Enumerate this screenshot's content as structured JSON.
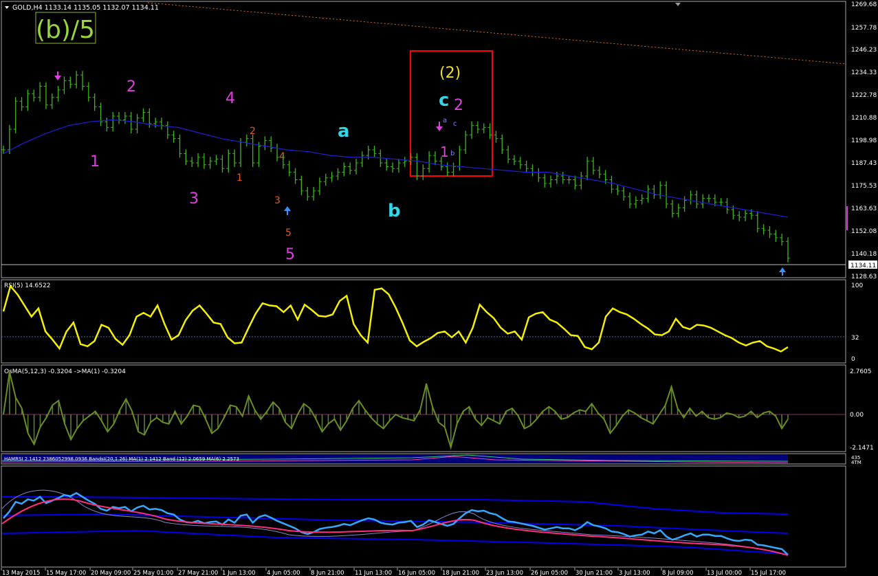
{
  "window": {
    "symbol_header": "GOLD,H4  1133.14 1135.05 1132.07 1134.11",
    "wave_title": "(b)/5"
  },
  "price_panel": {
    "y_labels": [
      "1269.68",
      "1257.78",
      "1246.23",
      "1234.33",
      "1222.78",
      "1210.88",
      "1198.98",
      "1187.43",
      "1175.53",
      "1163.63",
      "1152.08",
      "1140.18",
      "1128.63"
    ],
    "current_price": "1134.11",
    "wave_labels": [
      {
        "text": "2",
        "color": "#e040e0",
        "size": "big"
      },
      {
        "text": "4",
        "color": "#e040e0",
        "size": "big"
      },
      {
        "text": "1",
        "color": "#e040e0",
        "size": "big"
      },
      {
        "text": "3",
        "color": "#e040e0",
        "size": "big"
      },
      {
        "text": "5",
        "color": "#e040e0",
        "size": "big"
      },
      {
        "text": "2",
        "color": "#e05a20",
        "size": "small"
      },
      {
        "text": "4",
        "color": "#e05a20",
        "size": "small"
      },
      {
        "text": "1",
        "color": "#e05a20",
        "size": "small"
      },
      {
        "text": "3",
        "color": "#e05a20",
        "size": "small"
      },
      {
        "text": "5",
        "color": "#e05a20",
        "size": "small"
      },
      {
        "text": "a",
        "color": "#33d6e8",
        "size": "big"
      },
      {
        "text": "b",
        "color": "#33d6e8",
        "size": "big"
      },
      {
        "text": "c",
        "color": "#33d6e8",
        "size": "big"
      },
      {
        "text": "(2)",
        "color": "#f0e020",
        "size": "big"
      },
      {
        "text": "2",
        "color": "#e040e0",
        "size": "big"
      },
      {
        "text": "1",
        "color": "#e040e0",
        "size": "big"
      },
      {
        "text": "a",
        "color": "#8080ff",
        "size": "tiny"
      },
      {
        "text": "b",
        "color": "#8080ff",
        "size": "tiny"
      },
      {
        "text": "c",
        "color": "#8080ff",
        "size": "tiny"
      }
    ]
  },
  "rsi_panel": {
    "label": "RSI(5) 14.6522",
    "y_labels": [
      "100",
      "32",
      "0"
    ]
  },
  "osma_panel": {
    "label": "OsMA(5,12,3) -0.3204  ->MA(1) -0.3204",
    "y_labels": [
      "2.7605",
      "0.00",
      "-2.1471"
    ]
  },
  "mini_panel": {
    "label": "HAMRSI 2.1412 2386052998.0936   BandsI(20,1.26)        MA(1) 2.1412        Band (12) 2.0659        MA(6) 2.2573",
    "y_labels": [
      "435",
      "4TM"
    ]
  },
  "time_axis": [
    "13 May 2015",
    "15 May 17:00",
    "20 May 09:00",
    "25 May 01:00",
    "27 May 21:00",
    "1 Jun 13:00",
    "4 Jun 05:00",
    "8 Jun 21:00",
    "11 Jun 13:00",
    "16 Jun 05:00",
    "18 Jun 21:00",
    "23 Jun 13:00",
    "26 Jun 05:00",
    "30 Jun 21:00",
    "3 Jul 13:00",
    "8 Jul 09:00",
    "13 Jul 00:00",
    "15 Jul 17:00"
  ],
  "colors": {
    "background": "#000000",
    "candles": "#3cb818",
    "moving_average": "#1e1ed8",
    "rsi": "#f5f000",
    "osma": "#6b8e23",
    "box": "#ff0000",
    "band": "#0000ee",
    "cyan_line": "#33aaff",
    "pink_line": "#ff2e7e"
  },
  "chart_data": [
    {
      "type": "line",
      "title": "GOLD,H4",
      "ylim": [
        1124,
        1271
      ],
      "series": [
        {
          "name": "GOLD,H4",
          "values": [
            1192,
            1203,
            1218,
            1215,
            1222,
            1220,
            1226,
            1216,
            1220,
            1224,
            1229,
            1227,
            1232,
            1226,
            1220,
            1215,
            1207,
            1204,
            1210,
            1208,
            1210,
            1203,
            1209,
            1212,
            1206,
            1207,
            1205,
            1200,
            1198,
            1190,
            1186,
            1185,
            1188,
            1184,
            1186,
            1187,
            1182,
            1190,
            1185,
            1196,
            1198,
            1185,
            1194,
            1197,
            1193,
            1188,
            1184,
            1180,
            1176,
            1170,
            1167,
            1170,
            1175,
            1177,
            1178,
            1180,
            1183,
            1181,
            1185,
            1189,
            1192,
            1190,
            1185,
            1183,
            1182,
            1185,
            1186,
            1188,
            1178,
            1182,
            1189,
            1186,
            1183,
            1180,
            1183,
            1192,
            1200,
            1205,
            1203,
            1204,
            1200,
            1198,
            1192,
            1187,
            1186,
            1184,
            1182,
            1180,
            1177,
            1174,
            1176,
            1178,
            1176,
            1176,
            1173,
            1178,
            1186,
            1181,
            1179,
            1176,
            1171,
            1170,
            1167,
            1163,
            1165,
            1166,
            1171,
            1168,
            1173,
            1163,
            1158,
            1161,
            1165,
            1168,
            1163,
            1166,
            1166,
            1164,
            1164,
            1160,
            1157,
            1156,
            1158,
            1157,
            1150,
            1149,
            1147,
            1145,
            1143,
            1134
          ]
        },
        {
          "name": "MA",
          "values": [
            1190,
            1196,
            1201,
            1205,
            1207,
            1208,
            1207,
            1205,
            1204,
            1201,
            1198,
            1196,
            1194,
            1192,
            1191,
            1189,
            1188,
            1188,
            1187,
            1186,
            1184,
            1183,
            1182,
            1181,
            1180,
            1180,
            1178,
            1176,
            1174,
            1171,
            1168,
            1166,
            1164,
            1162,
            1160,
            1158,
            1156
          ]
        }
      ]
    },
    {
      "type": "line",
      "title": "RSI(5) 14.6522",
      "ylim": [
        0,
        100
      ],
      "series": [
        {
          "name": "RSI(5)",
          "values": [
            62,
            96,
            85,
            70,
            55,
            66,
            35,
            24,
            12,
            35,
            47,
            18,
            15,
            22,
            44,
            40,
            25,
            17,
            30,
            55,
            60,
            55,
            70,
            45,
            24,
            30,
            50,
            63,
            70,
            59,
            47,
            45,
            27,
            19,
            20,
            40,
            59,
            73,
            70,
            69,
            61,
            70,
            51,
            71,
            64,
            56,
            55,
            58,
            76,
            83,
            45,
            30,
            20,
            91,
            93,
            85,
            67,
            46,
            23,
            15,
            21,
            26,
            33,
            35,
            27,
            35,
            20,
            40,
            71,
            61,
            53,
            40,
            32,
            35,
            24,
            54,
            59,
            61,
            51,
            47,
            39,
            30,
            29,
            14,
            11,
            20,
            55,
            66,
            61,
            58,
            52,
            45,
            39,
            31,
            30,
            35,
            52,
            41,
            38,
            44,
            43,
            40,
            35,
            30,
            26,
            20,
            16,
            20,
            22,
            15,
            12,
            8,
            14
          ]
        }
      ]
    },
    {
      "type": "bar",
      "title": "OsMA(5,12,3) -0.3204",
      "ylim": [
        -2.1471,
        2.7605
      ],
      "series": [
        {
          "name": "OsMA",
          "values": [
            0.0,
            2.76,
            1.1,
            0.4,
            -1.2,
            -1.9,
            -0.8,
            -0.2,
            0.6,
            0.9,
            -0.6,
            -1.6,
            -0.9,
            -0.4,
            -0.1,
            0.2,
            -0.4,
            -1.1,
            -0.6,
            0.3,
            1.0,
            0.2,
            -1.1,
            -1.3,
            -0.5,
            -0.2,
            -0.5,
            -0.6,
            0.2,
            -0.6,
            -0.1,
            0.6,
            0.5,
            -0.3,
            -1.2,
            -0.9,
            -0.2,
            0.6,
            0.5,
            -0.1,
            1.2,
            0.3,
            -0.3,
            0.2,
            0.8,
            0.4,
            -0.5,
            -0.9,
            0.0,
            0.7,
            0.4,
            -0.3,
            -1.1,
            -0.6,
            -0.3,
            -1.0,
            -0.4,
            0.4,
            0.9,
            0.3,
            -0.2,
            -0.6,
            -0.9,
            -0.4,
            0.0,
            -0.2,
            -0.3,
            -0.4,
            0.3,
            2.0,
            0.5,
            -0.5,
            -0.8,
            -2.1,
            -0.6,
            0.2,
            0.5,
            -0.3,
            -0.7,
            -0.2,
            -0.4,
            -0.6,
            0.2,
            0.4,
            -0.1,
            -0.9,
            -0.7,
            -0.3,
            0.2,
            0.5,
            0.2,
            -0.3,
            -0.2,
            0.1,
            0.3,
            0.2,
            0.7,
            0.1,
            -0.3,
            -1.2,
            -0.7,
            -0.1,
            0.3,
            0.1,
            -0.2,
            -0.4,
            -0.6,
            0.0,
            0.6,
            1.8,
            0.4,
            -0.2,
            0.4,
            -0.1,
            0.2,
            -0.2,
            -0.3,
            -0.2,
            0.1,
            0.0,
            -0.2,
            -0.1,
            0.2,
            -0.2,
            0.1,
            0.2,
            -0.1,
            -0.9,
            -0.3
          ]
        }
      ]
    }
  ]
}
